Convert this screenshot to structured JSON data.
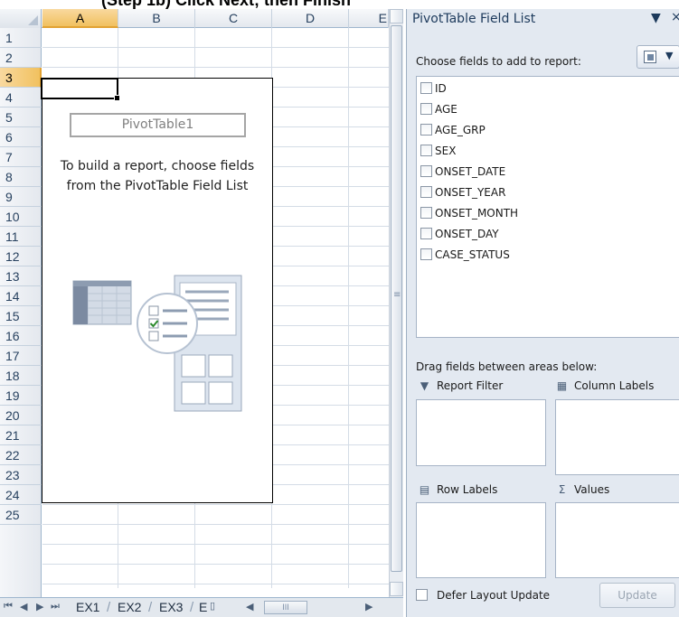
{
  "top_strip": {
    "text": "(Step 1b) Click Next; then Finish"
  },
  "sheet": {
    "columns": [
      "A",
      "B",
      "C",
      "D",
      "E"
    ],
    "selected_column": "A",
    "rows": [
      "1",
      "2",
      "3",
      "4",
      "5",
      "6",
      "7",
      "8",
      "9",
      "10",
      "11",
      "12",
      "13",
      "14",
      "15",
      "16",
      "17",
      "18",
      "19",
      "20",
      "21",
      "22",
      "23",
      "24",
      "25"
    ],
    "selected_row": "3"
  },
  "pivot": {
    "name": "PivotTable1",
    "instruction_line1": "To build a report, choose fields",
    "instruction_line2": "from the PivotTable Field List"
  },
  "tabs": {
    "items": [
      "EX1",
      "EX2",
      "EX3",
      "E"
    ],
    "scroll_grip": "III"
  },
  "pane": {
    "title": "PivotTable Field List",
    "choose_label": "Choose fields to add to report:",
    "fields": [
      "ID",
      "AGE",
      "AGE_GRP",
      "SEX",
      "ONSET_DATE",
      "ONSET_YEAR",
      "ONSET_MONTH",
      "ONSET_DAY",
      "CASE_STATUS"
    ],
    "drag_label": "Drag fields between areas below:",
    "areas": {
      "report_filter": "Report Filter",
      "column_labels": "Column Labels",
      "row_labels": "Row Labels",
      "values": "Values",
      "values_symbol": "Σ"
    },
    "defer_label": "Defer Layout Update",
    "update_label": "Update"
  }
}
